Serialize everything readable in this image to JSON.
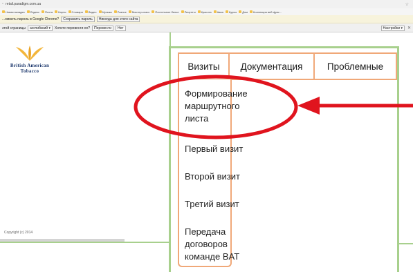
{
  "browser": {
    "url": "retail.paradigm.com.ua",
    "bookmarks": [
      "Новая вкладка",
      "Яндекс",
      "Почта",
      "Карты",
      "Словари",
      "Видео",
      "Музыка",
      "Разное",
      "Мастер-класс",
      "Постельное белье",
      "Рецепты",
      "Красота",
      "Авиа",
      "Курсы",
      "Дом",
      "Коллекция веб-фраг..."
    ],
    "password_prompt": {
      "text": "...омнить пароль в Google Chrome?",
      "save_label": "Сохранить пароль",
      "never_label": "Никогда для этого сайта"
    },
    "translate_bar": {
      "text": "этой страницы",
      "language": "английский ▾",
      "question": "Хотите перевести ее?",
      "translate_label": "Перевести",
      "no_label": "Нет",
      "settings_label": "Настройки ▾"
    }
  },
  "logo": {
    "line1": "British American",
    "line2": "Tobacco"
  },
  "footer": {
    "copyright": "Copyright (c) 2014"
  },
  "tabs": [
    {
      "label": "Визиты"
    },
    {
      "label": "Документация"
    },
    {
      "label": "Проблемные"
    }
  ],
  "dropdown": {
    "items": [
      {
        "label": "Формирование маршрутного листа"
      },
      {
        "label": "Первый визит"
      },
      {
        "label": "Второй визит"
      },
      {
        "label": "Третий визит"
      },
      {
        "label": "Передача договоров команде BAT"
      }
    ]
  },
  "colors": {
    "accent_orange": "#f0a878",
    "frame_green": "#a8d08d",
    "annotation_red": "#e0141e",
    "logo_gold": "#f3b63c",
    "logo_navy": "#1f3a6e"
  }
}
